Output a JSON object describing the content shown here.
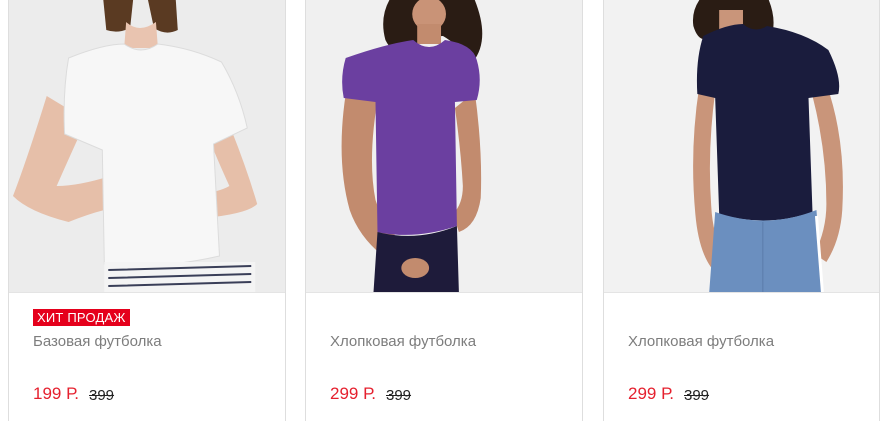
{
  "products": [
    {
      "badge": "ХИТ ПРОДАЖ",
      "name": "Базовая футболка",
      "price": "199 Р.",
      "old_price": "399",
      "tshirt_color": "#f7f7f7",
      "photo_bg": "#ececec"
    },
    {
      "name": "Хлопковая футболка",
      "price": "299 Р.",
      "old_price": "399",
      "tshirt_color": "#6b3fa0",
      "photo_bg": "#f0f0f0"
    },
    {
      "name": "Хлопковая футболка",
      "price": "299 Р.",
      "old_price": "399",
      "tshirt_color": "#1a1c3d",
      "photo_bg": "#f2f2f2"
    }
  ]
}
